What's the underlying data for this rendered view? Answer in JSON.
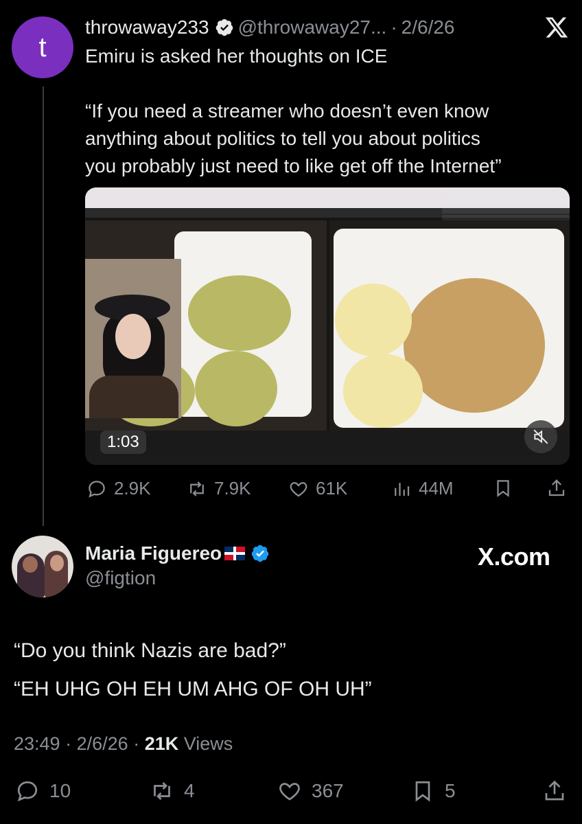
{
  "first_tweet": {
    "avatar_letter": "t",
    "avatar_color": "#7b2fbf",
    "display_name": "throwaway233",
    "handle": "@throwaway27...",
    "separator": "·",
    "date": "2/6/26",
    "text_line1": "Emiru is asked her thoughts on ICE",
    "quote_line1": "“If you need a streamer who doesn’t even know",
    "quote_line2": "anything about politics to tell you about politics",
    "quote_line3": "you probably just need to like get off the Internet”",
    "video": {
      "timecode": "1:03",
      "muted": true
    },
    "actions": {
      "replies": "2.9K",
      "reposts": "7.9K",
      "likes": "61K",
      "views": "44M"
    }
  },
  "reply_tweet": {
    "display_name": "Maria Figuereo",
    "flag": "dominican-republic-flag",
    "handle": "@figtion",
    "watermark": "X.com",
    "line1": "“Do you think Nazis are bad?”",
    "line2": "“EH UHG OH EH UM AHG OF OH UH”",
    "time": "23:49",
    "separator": "·",
    "date": "2/6/26",
    "views_count": "21K",
    "views_label": "Views",
    "actions": {
      "replies": "10",
      "reposts": "4",
      "likes": "367",
      "bookmarks": "5"
    }
  },
  "colors": {
    "background": "#000000",
    "text_primary": "#e7e9ea",
    "text_secondary": "#8b8f94",
    "verified_blue": "#1d9bf0"
  }
}
